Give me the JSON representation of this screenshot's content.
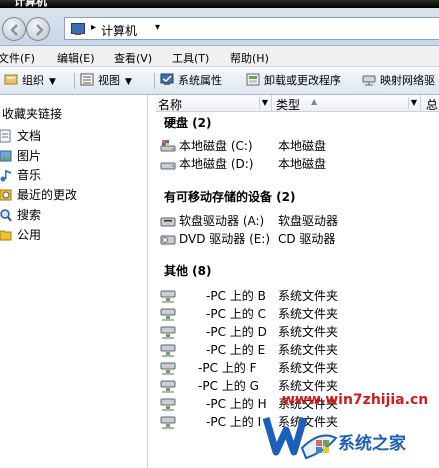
{
  "window": {
    "title": "计算机"
  },
  "address": {
    "location": "计算机"
  },
  "menu": [
    "文件(F)",
    "编辑(E)",
    "查看(V)",
    "工具(T)",
    "帮助(H)"
  ],
  "toolbar": {
    "organize": "组织",
    "views": "视图",
    "system_properties": "系统属性",
    "uninstall": "卸载或更改程序",
    "map_drive": "映射网络驱"
  },
  "nav": {
    "heading": "收藏夹链接",
    "links": [
      "文档",
      "图片",
      "音乐",
      "最近的更改",
      "搜索",
      "公用"
    ]
  },
  "columns": {
    "name": "名称",
    "type": "类型",
    "third": "总"
  },
  "groups": {
    "hard_disks": {
      "title": "硬盘 (2)",
      "items": [
        {
          "name": "本地磁盘 (C:)",
          "type": "本地磁盘"
        },
        {
          "name": "本地磁盘 (D:)",
          "type": "本地磁盘"
        }
      ]
    },
    "removable": {
      "title": "有可移动存储的设备 (2)",
      "items": [
        {
          "name": "软盘驱动器 (A:)",
          "type": "软盘驱动器"
        },
        {
          "name": "DVD 驱动器 (E:)",
          "type": "CD 驱动器"
        }
      ]
    },
    "other": {
      "title": "其他 (8)",
      "items": [
        {
          "name": "-PC 上的 B",
          "type": "系统文件夹"
        },
        {
          "name": "-PC 上的 C",
          "type": "系统文件夹"
        },
        {
          "name": "-PC 上的 D",
          "type": "系统文件夹"
        },
        {
          "name": "-PC 上的 E",
          "type": "系统文件夹"
        },
        {
          "name": "-PC 上的 F",
          "type": "系统文件夹"
        },
        {
          "name": "-PC 上的 G",
          "type": "系统文件夹"
        },
        {
          "name": "-PC 上的 H",
          "type": "系统文件夹"
        },
        {
          "name": "-PC 上的 I",
          "type": "系统文件夹"
        }
      ]
    }
  },
  "watermark": {
    "url": "www.win7zhijia.cn",
    "brand": "系统之家"
  },
  "colors": {
    "watermark_red": "#d41a1a",
    "watermark_blue": "#1b5fb8",
    "toolbar_border": "#a9b8c7"
  }
}
